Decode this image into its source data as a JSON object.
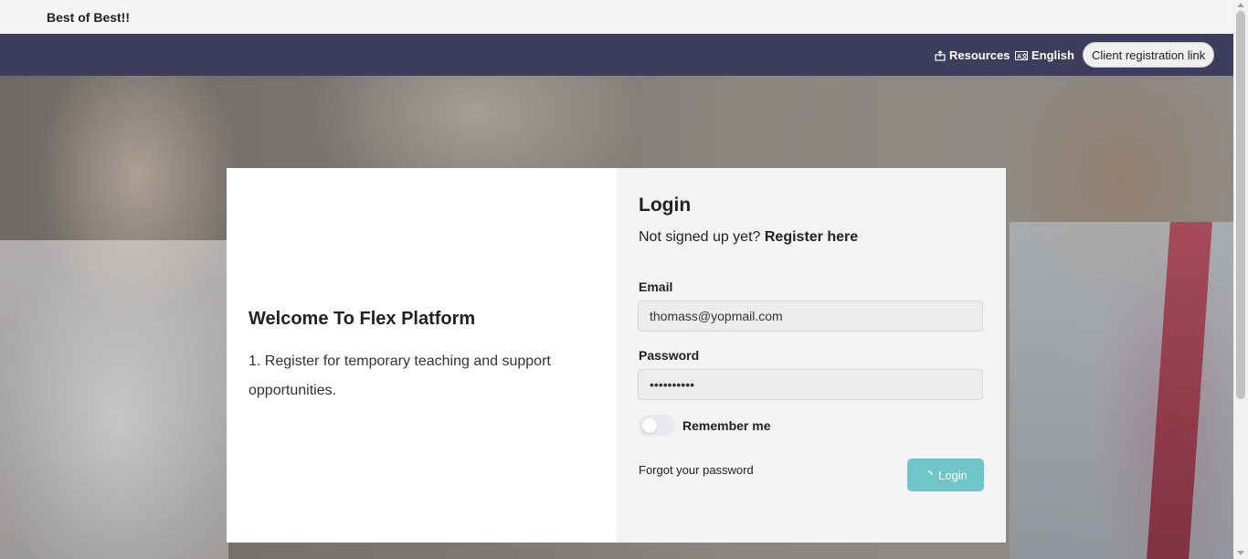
{
  "brand": {
    "name": "Best of Best!!"
  },
  "nav": {
    "resources_label": "Resources",
    "resources_icon": "resources-icon",
    "language_label": "English",
    "language_icon": "translate-icon",
    "client_registration_label": "Client registration link"
  },
  "welcome": {
    "title": "Welcome To Flex Platform",
    "text": "1. Register for temporary teaching and support opportunities."
  },
  "login": {
    "title": "Login",
    "signup_prefix": "Not signed up yet?",
    "signup_link": "Register here",
    "email_label": "Email",
    "email_value": "thomass@yopmail.com",
    "password_label": "Password",
    "password_value": "••••••••••",
    "remember_label": "Remember me",
    "remember_checked": false,
    "forgot_label": "Forgot your password",
    "login_button_label": "Login",
    "login_icon": "spinner-icon"
  },
  "colors": {
    "navbar": "#3f3d5e",
    "login_button": "#6ec6c9"
  }
}
